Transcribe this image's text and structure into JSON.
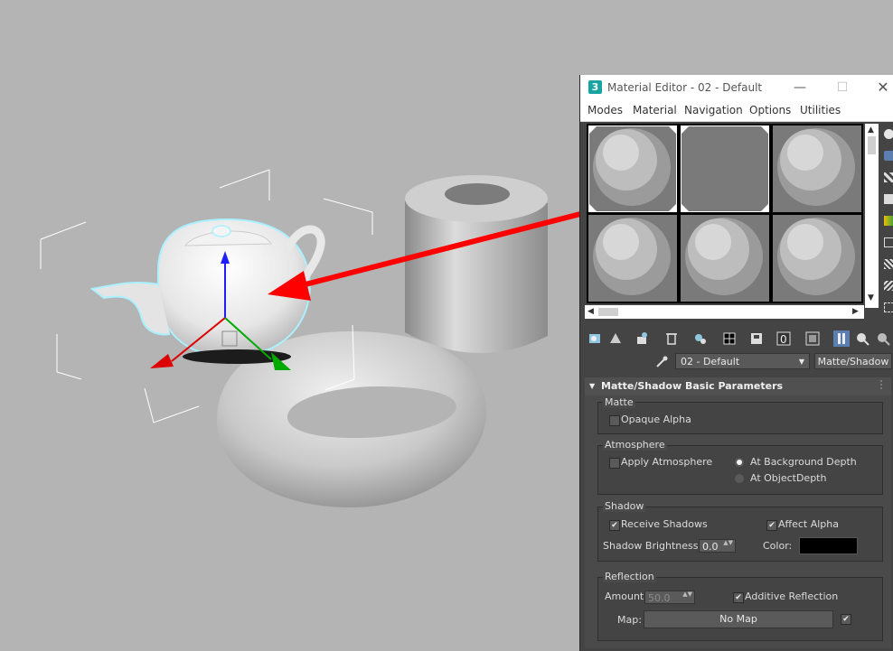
{
  "window": {
    "app_icon_text": "3",
    "title": "Material Editor - 02 - Default",
    "min_glyph": "—",
    "max_glyph": "☐",
    "close_glyph": "✕"
  },
  "menu": [
    "Modes",
    "Material",
    "Navigation",
    "Options",
    "Utilities"
  ],
  "material": {
    "name": "02 - Default",
    "type": "Matte/Shadow"
  },
  "rollout": {
    "title": "Matte/Shadow Basic Parameters",
    "matte": {
      "label": "Matte",
      "opaque_alpha": {
        "label": "Opaque Alpha",
        "checked": false
      }
    },
    "atmosphere": {
      "label": "Atmosphere",
      "apply_atmosphere": {
        "label": "Apply Atmosphere",
        "checked": false
      },
      "at_background_depth": {
        "label": "At Background Depth",
        "selected": true
      },
      "at_object_depth": {
        "label": "At ObjectDepth",
        "selected": false
      }
    },
    "shadow": {
      "label": "Shadow",
      "receive_shadows": {
        "label": "Receive Shadows",
        "checked": true
      },
      "affect_alpha": {
        "label": "Affect Alpha",
        "checked": true
      },
      "brightness_label": "Shadow Brightness:",
      "brightness_value": "0.0",
      "color_label": "Color:",
      "color": "#000000"
    },
    "reflection": {
      "label": "Reflection",
      "amount_label": "Amount:",
      "amount_value": "50.0",
      "additive": {
        "label": "Additive Reflection",
        "checked": true
      },
      "map_label": "Map:",
      "map_button": "No Map",
      "map_enabled": true
    }
  },
  "glyphs": {
    "check": "✔",
    "dropdown": "▼",
    "spinner": "▲▼",
    "collapse": "▼",
    "scroll_up": "▲",
    "scroll_down": "▼",
    "scroll_left": "◀",
    "scroll_right": "▶"
  },
  "colors": {
    "arrow": "#ff0000",
    "selection_outline": "#aaf0ff"
  }
}
